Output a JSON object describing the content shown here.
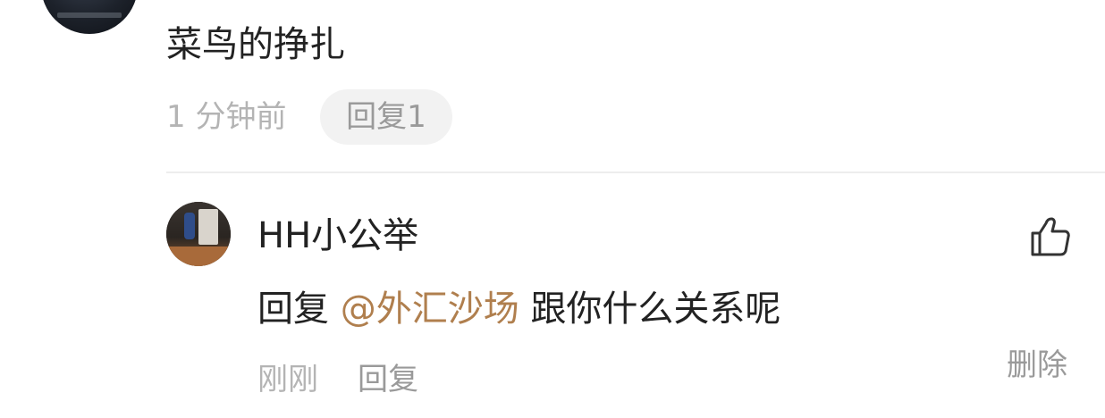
{
  "top_comment": {
    "text": "菜鸟的挣扎",
    "time": "1 分钟前",
    "reply_button": "回复1"
  },
  "reply_comment": {
    "username": "HH小公举",
    "reply_prefix": "回复",
    "mention": "@外汇沙场",
    "body": "跟你什么关系呢",
    "time": "刚刚",
    "reply_button": "回复",
    "delete_button": "删除",
    "like_icon": "thumbs-up-icon"
  },
  "colors": {
    "text_primary": "#222222",
    "text_secondary": "#b4b4b4",
    "action_text": "#9a9a9a",
    "mention": "#b07f4e",
    "pill_bg": "#f2f2f2",
    "divider": "#ededed"
  }
}
